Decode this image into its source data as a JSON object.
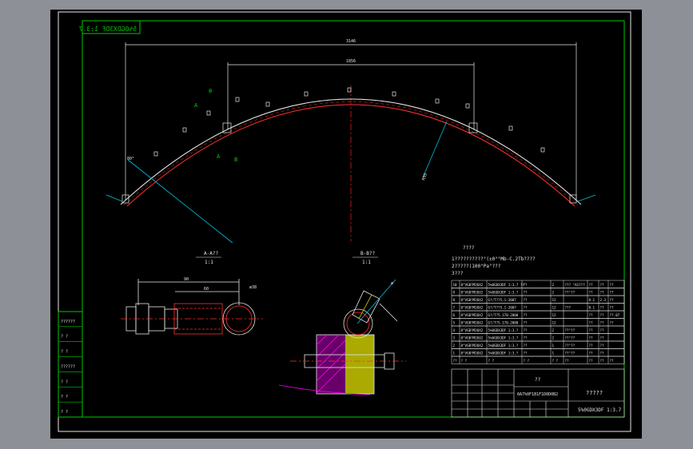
{
  "drawing": {
    "stamp_text": "5%0GDX3DF 1:3.7",
    "dims": {
      "outer_span": "3146",
      "inner_span": "1856",
      "left_angle": "80°",
      "right_angle": "R99",
      "dia": "ø38",
      "dia2": "ø",
      "len": "90",
      "len2": "60"
    },
    "marks": {
      "theta": "θ",
      "a_mark": "A",
      "b_mark": "B",
      "a_left": "A"
    },
    "section_a": {
      "title": "A-A??",
      "scale": "1:1"
    },
    "section_b": {
      "title": "B-B??",
      "scale": "1:1"
    },
    "notes": {
      "heading": "????",
      "line1": "1??????????°(±0°°Mb-C.2Tb????",
      "line2": "2?????(100°Pa°???",
      "line3": "3???"
    },
    "bom_rows": [
      [
        "10",
        "8°VGB?M20X2",
        "5%0GDX3DF 1:3.7 ??",
        "??",
        "2",
        "??? °A1???",
        "??",
        "??",
        "??"
      ],
      [
        "9",
        "8°VGB?M20X2",
        "5%0GDX3DF 1:3.?",
        "??",
        "2",
        "??°??",
        "??",
        "??",
        "??"
      ],
      [
        "8",
        "8°VGB?M20X2",
        "G?/T??5.1-2007",
        "??",
        "12",
        "",
        "8.1",
        "2.3",
        "??"
      ],
      [
        "7",
        "8°VGB?M20X2",
        "G?/T??5.1-2007",
        "??",
        "12",
        "???",
        "8.1",
        "??",
        "??"
      ],
      [
        "6",
        "8°VGB?M20X2",
        "G?/T?5.170-2000",
        "??",
        "12",
        "",
        "??",
        "??",
        "??.07"
      ],
      [
        "5",
        "8°VGB?M20X2",
        "G?/T?5.170-2000",
        "??",
        "12",
        "",
        "??",
        "??",
        "??"
      ],
      [
        "4",
        "8°VGB?M20X2",
        "5%0GDX3DF 1:3.?",
        "??",
        "2",
        "??°??",
        "??",
        "??",
        ""
      ],
      [
        "3",
        "8°VGB?M20X2",
        "5%0GDX3DF 1:3.?",
        "??",
        "2",
        "??°??",
        "??",
        "??",
        ""
      ],
      [
        "2",
        "8°VGB?M20X2",
        "5%0GDX3DF 1:3.?",
        "??",
        "1",
        "??°??",
        "??",
        "??",
        ""
      ],
      [
        "1",
        "8°VGB?M20X2",
        "5%0GDX3DF 1:3.?",
        "??",
        "1",
        "??°??",
        "??",
        "??",
        ""
      ]
    ],
    "header_row": [
      "??",
      "? ?",
      "? ?",
      "? ?",
      "? ?",
      "??",
      "??",
      "??",
      "??"
    ],
    "title_block": {
      "center_label": "??",
      "drawing_no": "0A7%0F1B1F1D0D0B2",
      "name": "?????",
      "code": "5%0GDX3DF 1:3.7",
      "small": [
        "?",
        "?",
        "?",
        "?",
        "?",
        "?",
        "?",
        "?"
      ]
    },
    "left_block": [
      "??????",
      "? ?",
      "? ?",
      "??????",
      "? ?",
      "? ?",
      "? ?"
    ]
  }
}
